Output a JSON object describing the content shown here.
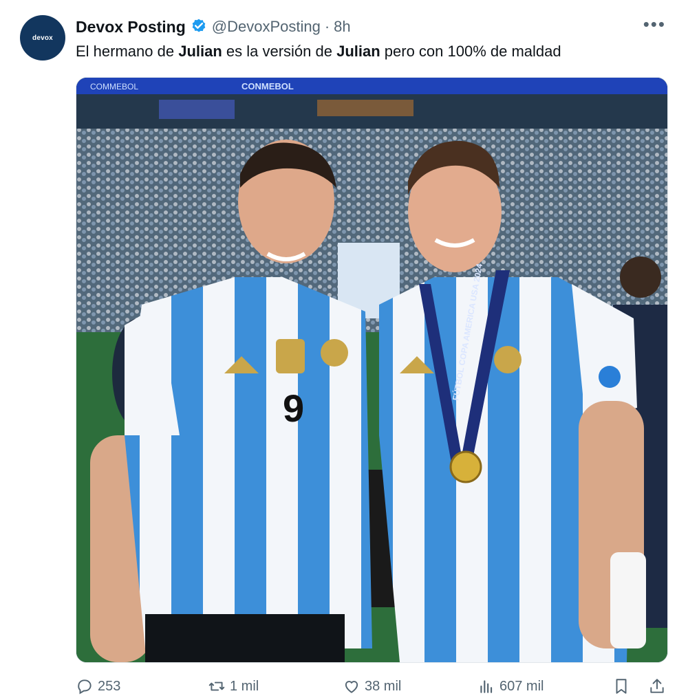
{
  "account": {
    "avatar_text": "devox",
    "display_name": "Devox Posting",
    "handle": "@DevoxPosting",
    "separator": "·",
    "time": "8h"
  },
  "tweet": {
    "text_parts": [
      "El hermano de ",
      "Julian",
      " es la versión de ",
      "Julian",
      " pero con 100% de maldad"
    ]
  },
  "photo": {
    "banner_left": "COMMEBOL",
    "banner_center": "CONMEBOL",
    "left_number": "9",
    "lanyard_text": "FÚTBOL COPA AMERICA USA 2024"
  },
  "actions": {
    "replies": "253",
    "reposts": "1 mil",
    "likes": "38 mil",
    "views": "607 mil"
  },
  "icons": [
    "verified-badge-icon",
    "more-icon",
    "reply-icon",
    "repost-icon",
    "like-icon",
    "views-icon",
    "bookmark-icon",
    "share-icon"
  ],
  "colors": {
    "verified": "#1d9bf0",
    "secondary_text": "#536471",
    "primary_text": "#0f1419"
  }
}
